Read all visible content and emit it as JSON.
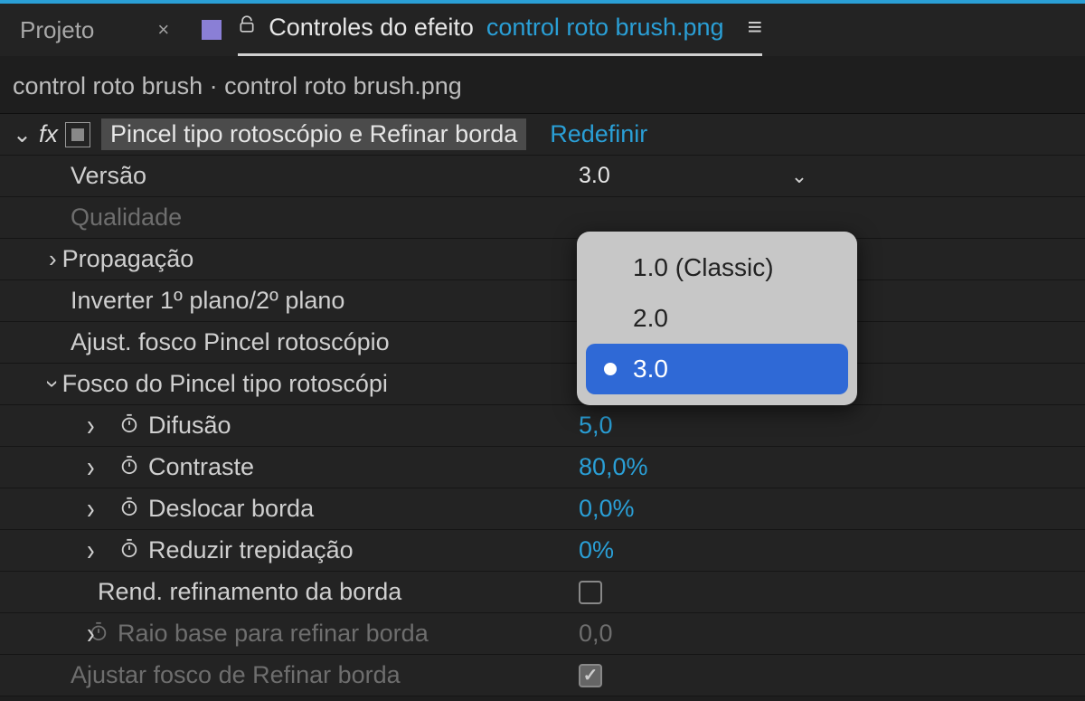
{
  "tabs": {
    "projeto_label": "Projeto",
    "active_prefix": "Controles do efeito",
    "active_file": "control roto brush.png"
  },
  "breadcrumb": "control roto brush · control roto brush.png",
  "effect": {
    "name": "Pincel tipo rotoscópio e Refinar borda",
    "reset_label": "Redefinir"
  },
  "rows": {
    "versao_label": "Versão",
    "versao_value": "3.0",
    "qualidade_label": "Qualidade",
    "propagacao_label": "Propagação",
    "inverter_label": "Inverter 1º plano/2º plano",
    "ajust_fosco_label": "Ajust. fosco Pincel rotoscópio",
    "fosco_group_label": "Fosco do Pincel tipo rotoscópi",
    "difusao_label": "Difusão",
    "difusao_value": "5,0",
    "contraste_label": "Contraste",
    "contraste_value": "80,0%",
    "deslocar_label": "Deslocar borda",
    "deslocar_value": "0,0%",
    "reduzir_label": "Reduzir trepidação",
    "reduzir_value": "0%",
    "rend_label": "Rend. refinamento da borda",
    "raio_label": "Raio base para refinar borda",
    "raio_value": "0,0",
    "ajustar_label": "Ajustar fosco de Refinar borda"
  },
  "dropdown": {
    "options": [
      "1.0 (Classic)",
      "2.0",
      "3.0"
    ],
    "selected_index": 2
  }
}
